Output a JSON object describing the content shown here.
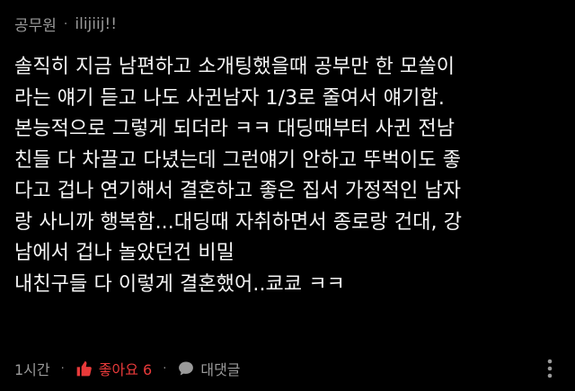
{
  "header": {
    "author": "공무원",
    "separator": "·",
    "username": "ilijiij!!"
  },
  "comment": {
    "lines": [
      "솔직히 지금 남편하고 소개팅했을때 공부만 한 모쏠이",
      "라는 얘기 듣고 나도 사귄남자 1/3로 줄여서 얘기함.",
      "본능적으로 그렇게 되더라 ㅋㅋ 대딩때부터 사귄 전남",
      "친들 다 차끌고 다녔는데 그런얘기 안하고 뚜벅이도 좋",
      "다고 겁나 연기해서 결혼하고 좋은 집서 가정적인 남자",
      "랑 사니까 행복함...대딩때 자취하면서 종로랑 건대, 강",
      "남에서 겁나 놀았던건 비밀",
      "내친구들 다 이렇게 결혼했어..쿄쿄 ㅋㅋ"
    ]
  },
  "footer": {
    "time": "1시간",
    "sep": "·",
    "like_label": "좋아요 6",
    "reply_label": "대댓글"
  },
  "colors": {
    "background": "#000000",
    "text": "#f5f5f5",
    "muted": "#9a9a9a",
    "like": "#e83a3a"
  },
  "icons": {
    "like": "thumbs-up-icon",
    "reply": "speech-bubble-icon",
    "more": "more-vertical-icon"
  }
}
